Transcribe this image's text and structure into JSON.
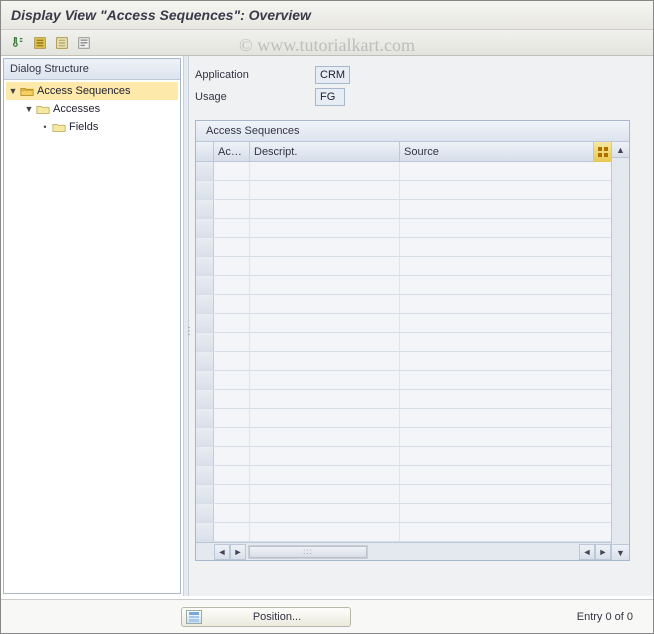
{
  "title": "Display View \"Access Sequences\": Overview",
  "watermark": "© www.tutorialkart.com",
  "tree": {
    "header": "Dialog Structure",
    "nodes": [
      {
        "label": "Access Sequences",
        "indent": 0,
        "open": true,
        "selected": true
      },
      {
        "label": "Accesses",
        "indent": 1,
        "open": true,
        "selected": false
      },
      {
        "label": "Fields",
        "indent": 2,
        "open": false,
        "selected": false,
        "leaf": true
      }
    ]
  },
  "fields": {
    "application_label": "Application",
    "application_value": "CRM",
    "usage_label": "Usage",
    "usage_value": "FG"
  },
  "grid": {
    "title": "Access Sequences",
    "columns": {
      "col1": "Ac…",
      "col2": "Descript.",
      "col3": "Source"
    },
    "row_count": 20
  },
  "bottom": {
    "position_label": "Position...",
    "entry_text": "Entry 0 of 0"
  }
}
